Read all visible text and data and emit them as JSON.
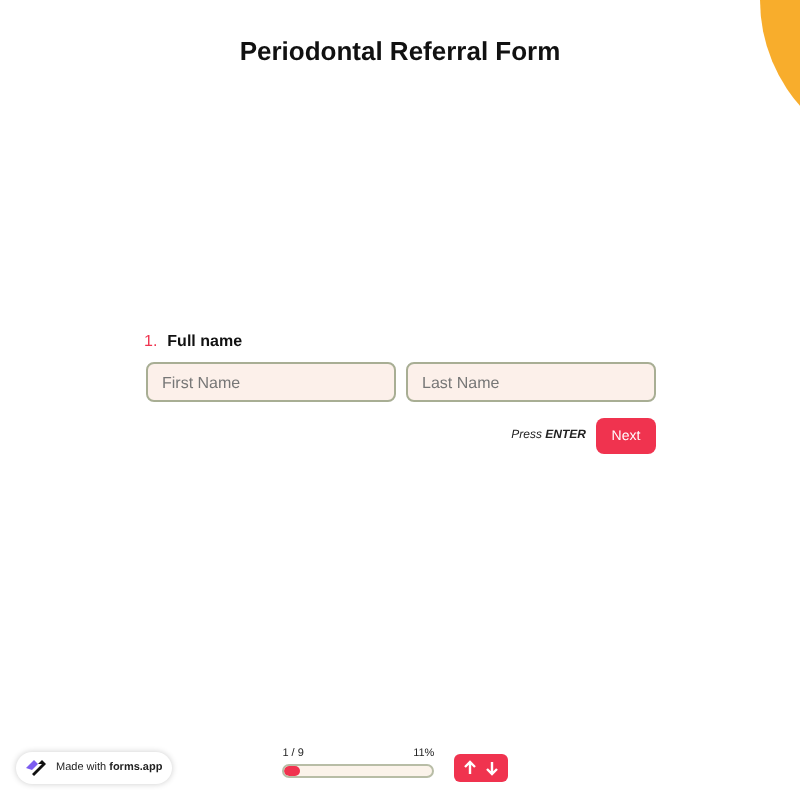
{
  "title": "Periodontal Referral Form",
  "question": {
    "number": "1.",
    "label": "Full name",
    "fields": [
      {
        "placeholder": "First Name"
      },
      {
        "placeholder": "Last Name"
      }
    ]
  },
  "hint": "Press **ENTER**",
  "next_button": "Next",
  "badge": "Made with **forms.app**",
  "progress": {
    "counter": "1 / 9",
    "percent": "11%",
    "level": 0.11
  }
}
